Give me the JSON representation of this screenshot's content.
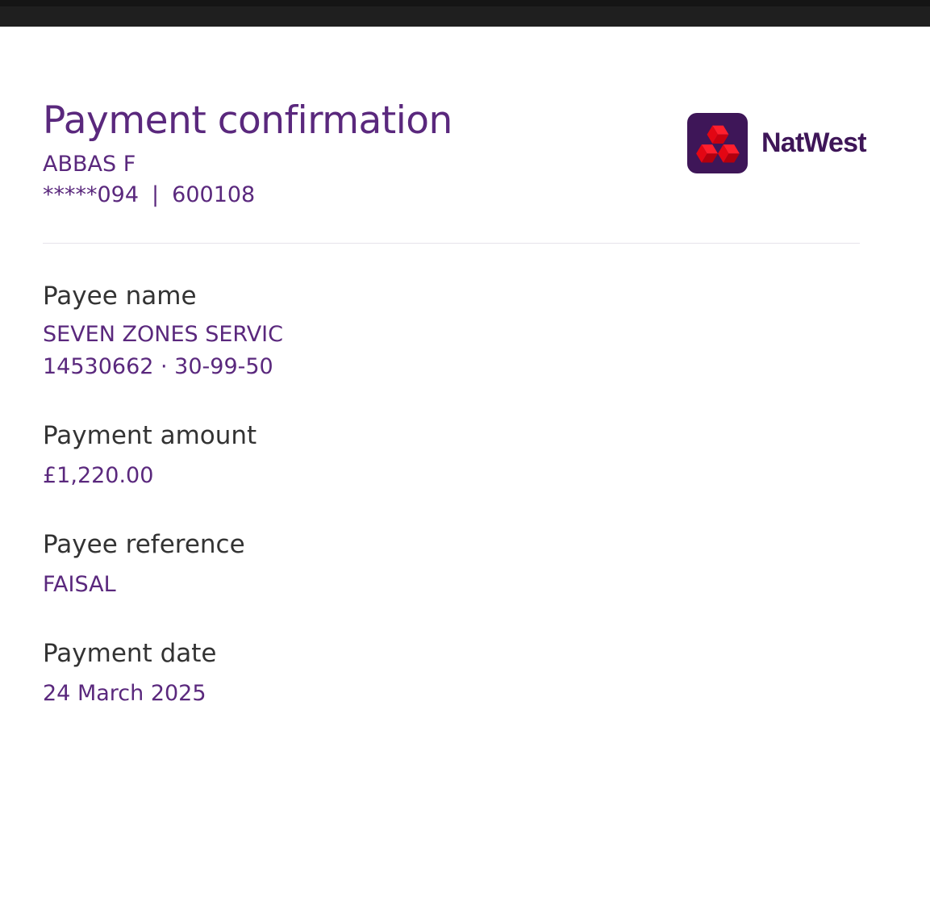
{
  "header": {
    "title": "Payment confirmation",
    "account_name": "ABBAS F",
    "account_number": "*****094",
    "separator": "|",
    "sort_code": "600108"
  },
  "brand": {
    "name": "NatWest",
    "icon": "natwest-cubes-logo",
    "colors": {
      "purple_dark": "#3e1658",
      "purple_text": "#5a287d",
      "red": "#e30613"
    }
  },
  "details": {
    "payee": {
      "label": "Payee name",
      "name": "SEVEN ZONES SERVIC",
      "account": "14530662 · 30-99-50"
    },
    "amount": {
      "label": "Payment amount",
      "value": "£1,220.00"
    },
    "reference": {
      "label": "Payee reference",
      "value": "FAISAL"
    },
    "date": {
      "label": "Payment date",
      "value": "24 March 2025"
    }
  }
}
